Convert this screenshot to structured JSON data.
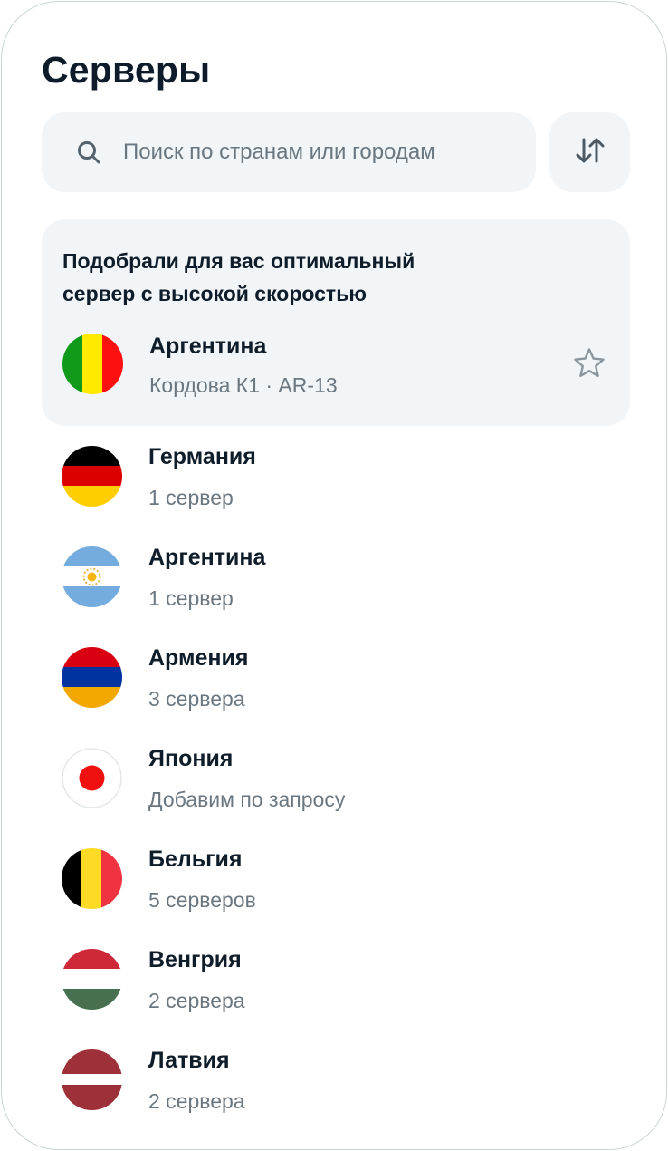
{
  "header": {
    "title": "Серверы"
  },
  "search": {
    "placeholder": "Поиск по странам или городам",
    "value": "",
    "icon": "search-icon"
  },
  "sort": {
    "icon": "sort-arrows-icon"
  },
  "recommended": {
    "text": "Подобрали для вас оптимальный сервер с высокой скоростью",
    "item": {
      "name": "Аргентина",
      "subtitle": "Кордова К1 · AR-13",
      "flag": "flag-green-yellow-red-icon"
    },
    "favorite_icon": "star-outline-icon"
  },
  "servers": [
    {
      "name": "Германия",
      "subtitle": "1 сервер",
      "flag": "germany-flag-icon"
    },
    {
      "name": "Аргентина",
      "subtitle": "1 сервер",
      "flag": "argentina-flag-icon"
    },
    {
      "name": "Армения",
      "subtitle": "3 сервера",
      "flag": "armenia-flag-icon"
    },
    {
      "name": "Япония",
      "subtitle": "Добавим по запросу",
      "flag": "japan-flag-icon"
    },
    {
      "name": "Бельгия",
      "subtitle": "5 серверов",
      "flag": "belgium-flag-icon"
    },
    {
      "name": "Венгрия",
      "subtitle": "2 сервера",
      "flag": "hungary-flag-icon"
    },
    {
      "name": "Латвия",
      "subtitle": "2 сервера",
      "flag": "latvia-flag-icon"
    }
  ],
  "colors": {
    "accent_bg": "#f1f5f8",
    "text": "#0f1c2a",
    "muted": "#6b7780",
    "border": "#c9d3d3"
  }
}
